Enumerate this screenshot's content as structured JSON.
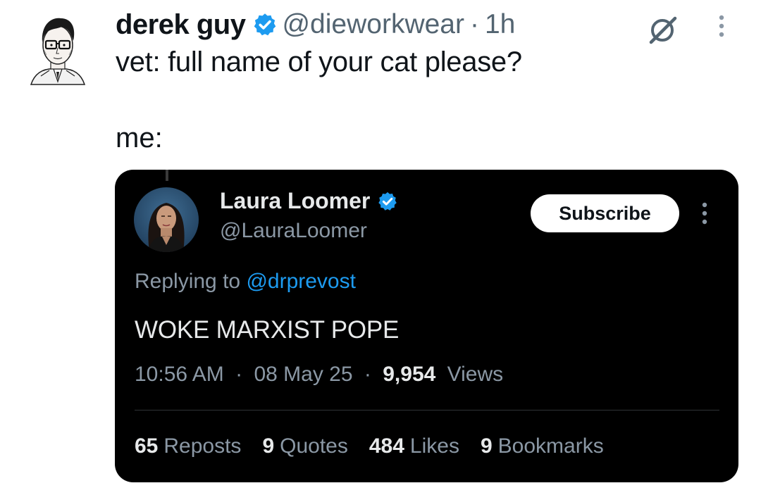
{
  "author": {
    "display_name": "derek guy",
    "handle": "@dieworkwear",
    "separator": "·",
    "time": "1h",
    "avatar_icon": "sketch-portrait-avatar",
    "verified_color": "#1d9bf0"
  },
  "tweet": {
    "line1": "vet: full name of your cat please?",
    "line2": "me:"
  },
  "quoted": {
    "display_name": "Laura Loomer",
    "handle": "@LauraLoomer",
    "subscribe_label": "Subscribe",
    "replying_prefix": "Replying to",
    "replying_to": "@drprevost",
    "text": "WOKE MARXIST POPE",
    "time": "10:56 AM",
    "sep1": "·",
    "date": "08 May 25",
    "sep2": "·",
    "views_count": "9,954",
    "views_label": "Views",
    "stats": [
      {
        "count": "65",
        "label": "Reposts"
      },
      {
        "count": "9",
        "label": "Quotes"
      },
      {
        "count": "484",
        "label": "Likes"
      },
      {
        "count": "9",
        "label": "Bookmarks"
      }
    ]
  },
  "icons": {
    "grok": "grok-icon",
    "more": "more-vertical-icon",
    "verified": "verified-badge-icon"
  },
  "colors": {
    "accent": "#1d9bf0",
    "card_bg": "#000000",
    "muted": "#536471"
  }
}
